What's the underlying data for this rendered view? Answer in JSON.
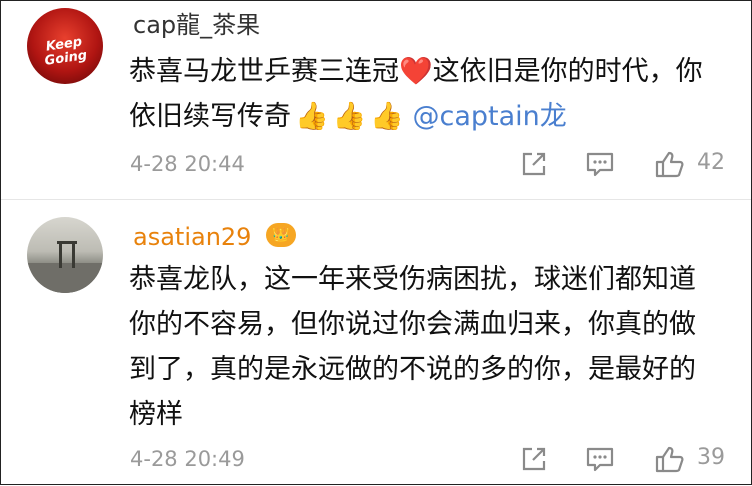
{
  "comments": [
    {
      "username": "cap龍_茶果",
      "avatar_text": "Keep Going",
      "text_before_heart": "恭喜马龙世乒赛三连冠",
      "heart": "❤️",
      "text_after_heart": "这依旧是你的时代，你依旧续写传奇",
      "thumbs": [
        "👍",
        "👍",
        "👍"
      ],
      "mention": "@captain龙",
      "time": "4-28 20:44",
      "likes": "42"
    },
    {
      "username": "asatian29",
      "badge": "👑",
      "text": "恭喜龙队，这一年来受伤病困扰，球迷们都知道你的不容易，但你说过你会满血归来，你真的做到了，真的是永远做的不说的多的你，是最好的榜样",
      "time": "4-28 20:49",
      "likes": "39"
    }
  ],
  "icons": {
    "share": "share-icon",
    "reply": "reply-icon",
    "like": "thumbs-up-icon"
  },
  "colors": {
    "username_default": "#333333",
    "username_vip": "#e8820c",
    "mention": "#4a7fcf",
    "meta": "#9a9a9a"
  }
}
